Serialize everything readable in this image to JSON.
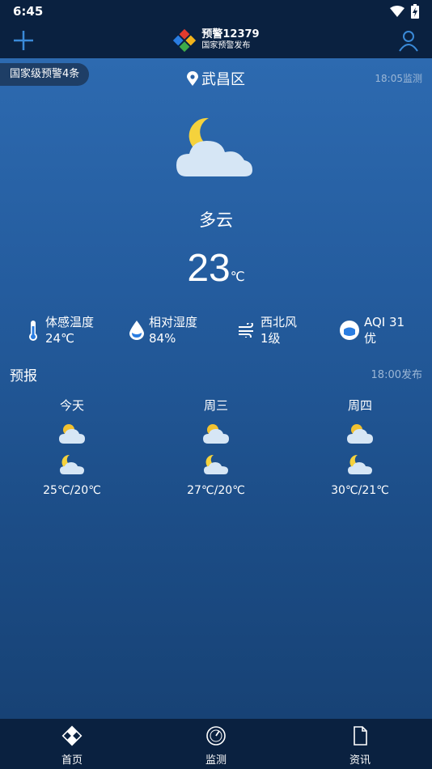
{
  "status": {
    "time": "6:45"
  },
  "app": {
    "title": "预警12379",
    "subtitle": "国家预警发布"
  },
  "warning": {
    "label": "国家级预警4条"
  },
  "location": {
    "name": "武昌区"
  },
  "monitor": {
    "time": "18:05监测"
  },
  "current": {
    "condition": "多云",
    "temp": "23",
    "unit": "℃"
  },
  "details": [
    {
      "label": "体感温度",
      "value": "24℃",
      "icon": "thermometer-icon"
    },
    {
      "label": "相对湿度",
      "value": "84%",
      "icon": "humidity-drop-icon"
    },
    {
      "label": "西北风",
      "value": "1级",
      "icon": "wind-icon"
    },
    {
      "label": "AQI 31",
      "value": "优",
      "icon": "aqi-mask-icon"
    }
  ],
  "forecast": {
    "title": "预报",
    "published": "18:00发布",
    "days": [
      {
        "day": "今天",
        "range": "25℃/20℃"
      },
      {
        "day": "周三",
        "range": "27℃/20℃"
      },
      {
        "day": "周四",
        "range": "30℃/21℃"
      }
    ]
  },
  "nav": [
    {
      "label": "首页",
      "icon": "home-diamond-icon"
    },
    {
      "label": "监测",
      "icon": "gauge-icon"
    },
    {
      "label": "资讯",
      "icon": "document-icon"
    }
  ],
  "colors": {
    "bar": "#0a2140",
    "accent": "#3a8ad8",
    "sun": "#f2c230",
    "moon": "#f5d23c",
    "cloud": "#d6e6f5"
  }
}
